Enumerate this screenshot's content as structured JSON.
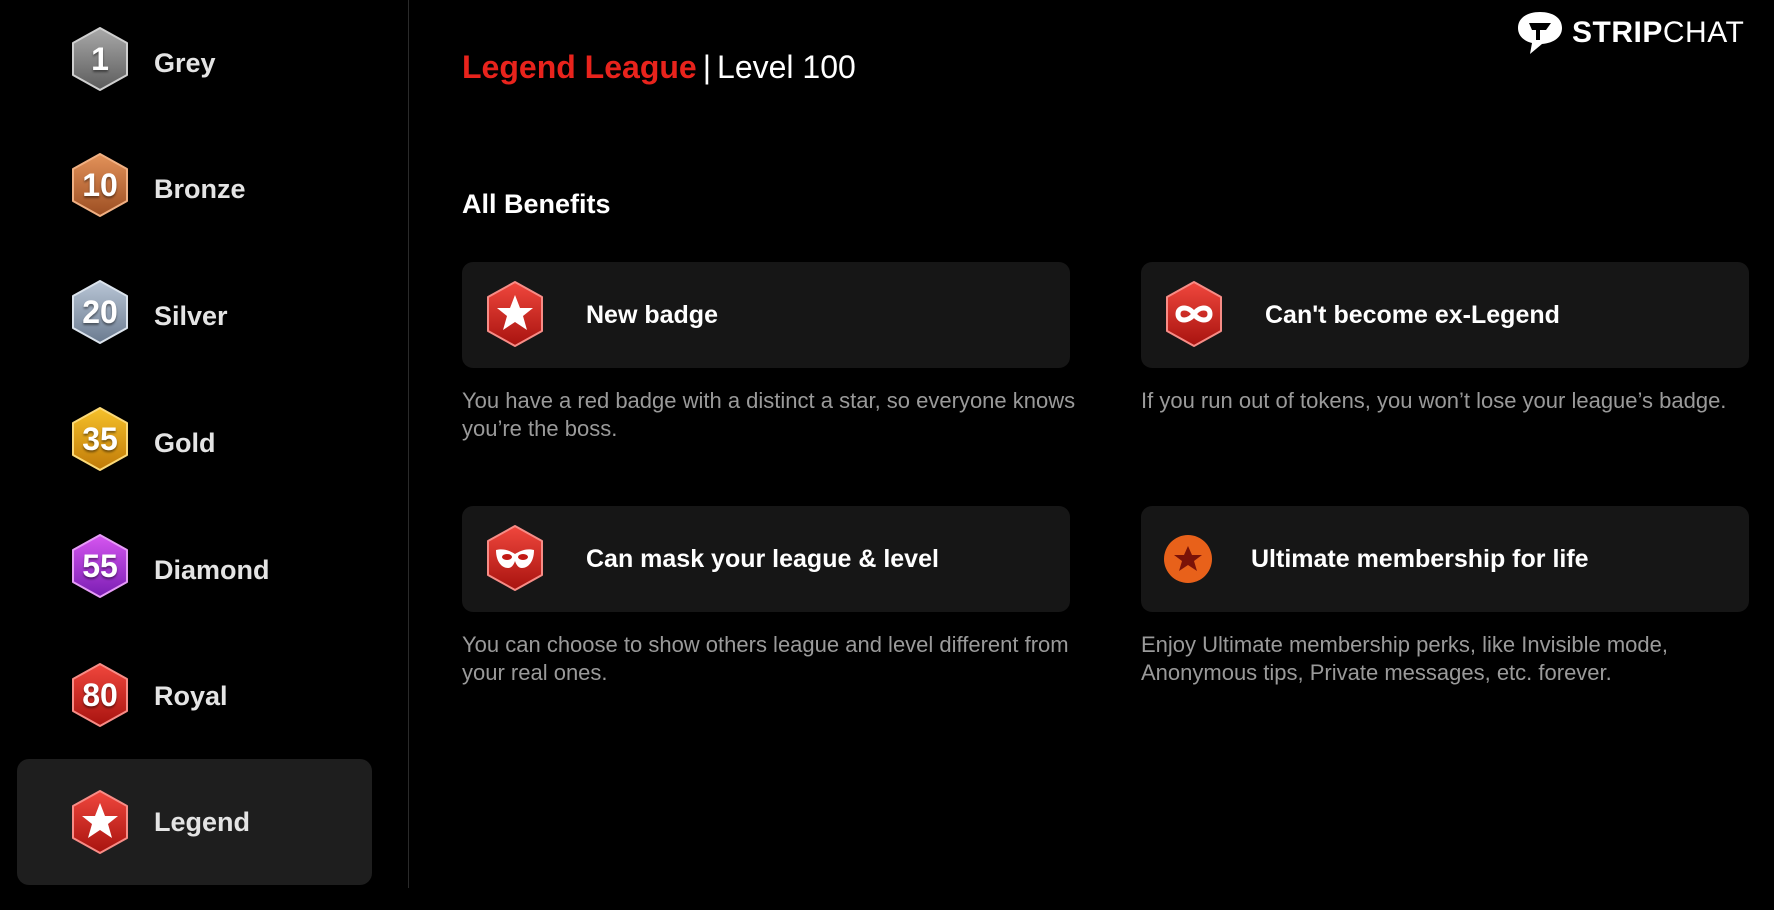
{
  "brand": {
    "name_bold": "STRIP",
    "name_light": "CHAT"
  },
  "sidebar": {
    "items": [
      {
        "num": "1",
        "label": "Grey",
        "color_top": "#a9a9a9",
        "color_bottom": "#5c5c5c"
      },
      {
        "num": "10",
        "label": "Bronze",
        "color_top": "#e3925a",
        "color_bottom": "#9c4e22"
      },
      {
        "num": "20",
        "label": "Silver",
        "color_top": "#b9c6d6",
        "color_bottom": "#6b7b90"
      },
      {
        "num": "35",
        "label": "Gold",
        "color_top": "#f6c12a",
        "color_bottom": "#c07a08"
      },
      {
        "num": "55",
        "label": "Diamond",
        "color_top": "#d656f0",
        "color_bottom": "#7a1db3"
      },
      {
        "num": "80",
        "label": "Royal",
        "color_top": "#f0473d",
        "color_bottom": "#a8130f"
      },
      {
        "num": "",
        "label": "Legend",
        "color_top": "#f0473d",
        "color_bottom": "#a8130f",
        "icon": "star-icon",
        "active": true
      }
    ]
  },
  "header": {
    "league": "Legend League",
    "separator": "|",
    "level": "Level 100"
  },
  "benefits": {
    "title": "All Benefits",
    "cards": [
      {
        "icon": "star-badge-icon",
        "title": "New badge",
        "description": "You have a red badge with a distinct a star, so everyone knows you’re the boss."
      },
      {
        "icon": "infinity-badge-icon",
        "title": "Can't become ex-Legend",
        "description": "If you run out of tokens, you won’t lose your league’s badge."
      },
      {
        "icon": "mask-badge-icon",
        "title": "Can mask your league & level",
        "description": "You can choose to show others league and level different from your real ones."
      },
      {
        "icon": "ultimate-star-icon",
        "title": "Ultimate membership for life",
        "description": "Enjoy Ultimate membership perks, like Invisible mode, Anonymous tips, Private messages, etc. forever."
      }
    ]
  },
  "colors": {
    "accent": "#e8231c",
    "card_bg": "#161616",
    "desc": "#9a9a9a"
  }
}
